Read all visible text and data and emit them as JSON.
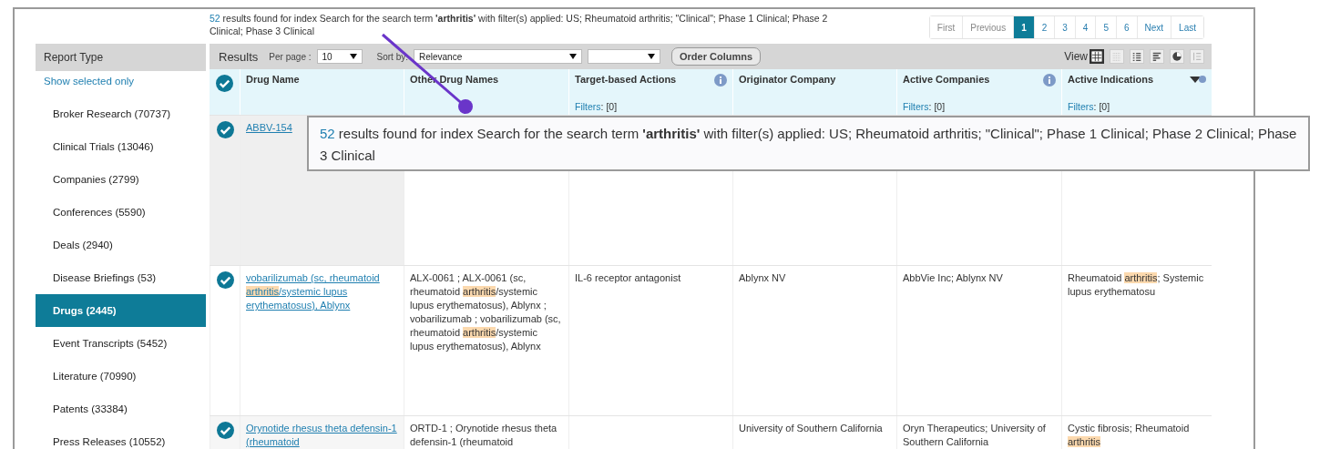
{
  "summary": {
    "count": "52",
    "text": "results found for index Search for the search term **'arthritis'** with filter(s) applied:  US; Rheumatoid arthritis; \"Clinical\"; Phase 1 Clinical; Phase 2 Clinical; Phase 3 Clinical"
  },
  "pagination": [
    {
      "label": "First",
      "selected": false
    },
    {
      "label": "Previous",
      "selected": false
    },
    {
      "label": "1",
      "selected": true
    },
    {
      "label": "2",
      "selected": false
    },
    {
      "label": "3",
      "selected": false
    },
    {
      "label": "4",
      "selected": false
    },
    {
      "label": "5",
      "selected": false
    },
    {
      "label": "6",
      "selected": false
    },
    {
      "label": "Next",
      "selected": false
    },
    {
      "label": "Last",
      "selected": false
    }
  ],
  "sidebar": {
    "title": "Report Type",
    "show_selected": "Show selected only",
    "items": [
      {
        "label": "Broker Research (70737)",
        "selected": false
      },
      {
        "label": "Clinical Trials (13046)",
        "selected": false
      },
      {
        "label": "Companies (2799)",
        "selected": false
      },
      {
        "label": "Conferences (5590)",
        "selected": false
      },
      {
        "label": "Deals (2940)",
        "selected": false
      },
      {
        "label": "Disease Briefings (53)",
        "selected": false
      },
      {
        "label": "Drugs (2445)",
        "selected": true
      },
      {
        "label": "Event Transcripts (5452)",
        "selected": false
      },
      {
        "label": "Literature (70990)",
        "selected": false
      },
      {
        "label": "Patents (33384)",
        "selected": false
      },
      {
        "label": "Press Releases (10552)",
        "selected": false
      }
    ]
  },
  "toolbar": {
    "title": "Results",
    "per_page_label": "Per page :",
    "per_page": "10",
    "sort_label": "Sort by:",
    "sort": "Relevance",
    "order_button": "Order Columns",
    "view_label": "View",
    "views": [
      {
        "kind": "grid",
        "selected": true
      },
      {
        "kind": "dots",
        "selected": false
      },
      {
        "kind": "list",
        "selected": false
      },
      {
        "kind": "bars",
        "selected": false
      },
      {
        "kind": "pie",
        "selected": false
      },
      {
        "kind": "detail",
        "selected": false
      }
    ]
  },
  "table": {
    "header_checked": true,
    "columns": [
      {
        "label": "Drug Name",
        "info": false
      },
      {
        "label": "Other Drug Names",
        "info": false
      },
      {
        "label": "Target-based Actions",
        "info": true,
        "filter_label": "Filters",
        "filter_value": ": [0]"
      },
      {
        "label": "Originator Company",
        "info": false
      },
      {
        "label": "Active Companies",
        "info": true,
        "filter_label": "Filters",
        "filter_value": ": [0]"
      },
      {
        "label": "Active Indications",
        "info": false,
        "filter_label": "Filters",
        "filter_value": ": [0]",
        "menu": true
      }
    ],
    "rows": [
      {
        "checked": true,
        "cells": [
          [
            {
              "text": "ABBV-154",
              "highlight": false
            }
          ],
          [],
          [],
          [],
          [],
          []
        ]
      },
      {
        "checked": true,
        "cells": [
          [
            {
              "text": "vobarilizumab (sc, rheumatoid ",
              "highlight": false
            },
            {
              "text": "arthritis",
              "highlight": true
            },
            {
              "text": "/systemic lupus erythematosus), Ablynx",
              "highlight": false
            }
          ],
          [
            {
              "text": "ALX-0061 ; ALX-0061 (sc, rheumatoid ",
              "highlight": false
            },
            {
              "text": "arthritis",
              "highlight": true
            },
            {
              "text": "/systemic lupus erythematosus), Ablynx ; vobarilizumab ; vobarilizumab (sc, rheumatoid ",
              "highlight": false
            },
            {
              "text": "arthritis",
              "highlight": true
            },
            {
              "text": "/systemic lupus erythematosus), Ablynx",
              "highlight": false
            }
          ],
          [
            {
              "text": "IL-6 receptor antagonist",
              "highlight": false
            }
          ],
          [
            {
              "text": "Ablynx NV",
              "highlight": false
            }
          ],
          [
            {
              "text": "AbbVie Inc; Ablynx NV",
              "highlight": false
            }
          ],
          [
            {
              "text": "Rheumatoid ",
              "highlight": false
            },
            {
              "text": "arthritis",
              "highlight": true
            },
            {
              "text": "; Systemic lupus erythematosu",
              "highlight": false
            }
          ]
        ]
      },
      {
        "checked": true,
        "cells": [
          [
            {
              "text": "Orynotide rhesus theta defensin-1 (rheumatoid",
              "highlight": false
            }
          ],
          [
            {
              "text": "ORTD-1 ; Orynotide rhesus theta defensin-1 (rheumatoid",
              "highlight": false
            }
          ],
          [],
          [
            {
              "text": "University of Southern California",
              "highlight": false
            }
          ],
          [
            {
              "text": "Oryn Therapeutics; University of Southern California",
              "highlight": false
            }
          ],
          [
            {
              "text": "Cystic fibrosis; Rheumatoid ",
              "highlight": false
            },
            {
              "text": "arthritis",
              "highlight": true
            }
          ]
        ]
      }
    ]
  },
  "callout": {
    "count": "52",
    "text": "results found for index Search for the search term **'arthritis'** with filter(s) applied:  US; Rheumatoid arthritis; \"Clinical\"; Phase 1 Clinical; Phase 2 Clinical; Phase 3 Clinical"
  }
}
